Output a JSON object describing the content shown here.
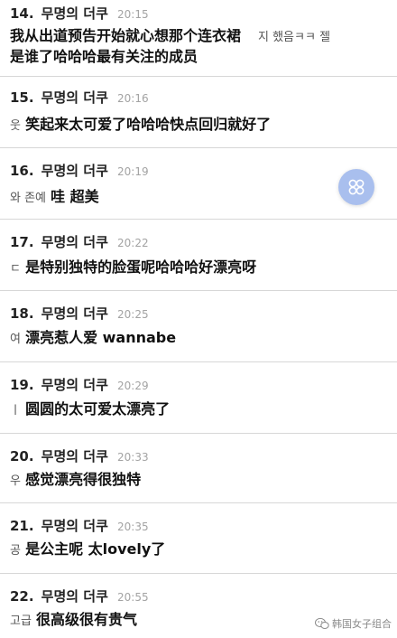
{
  "comments": [
    {
      "num": "14.",
      "user": "무명의 더쿠",
      "time": "20:15",
      "orig": "",
      "text": "我从出道预告开始就心想那个连衣裙",
      "text2": "是谁了哈哈哈最有关注的成员",
      "overlay_tail": "지 했음ㅋㅋ 젤"
    },
    {
      "num": "15.",
      "user": "무명의 더쿠",
      "time": "20:16",
      "orig": "웃",
      "text": "笑起来太可爱了哈哈哈快点回归就好了"
    },
    {
      "num": "16.",
      "user": "무명의 더쿠",
      "time": "20:19",
      "orig": "와 존예",
      "text": "哇 超美"
    },
    {
      "num": "17.",
      "user": "무명의 더쿠",
      "time": "20:22",
      "orig": "ㄷ",
      "text": "是特别独特的脸蛋呢哈哈哈好漂亮呀"
    },
    {
      "num": "18.",
      "user": "무명의 더쿠",
      "time": "20:25",
      "orig": "여",
      "text": "漂亮惹人爱 wannabe"
    },
    {
      "num": "19.",
      "user": "무명의 더쿠",
      "time": "20:29",
      "orig": "ㅣ",
      "text": "圆圆的太可爱太漂亮了"
    },
    {
      "num": "20.",
      "user": "무명의 더쿠",
      "time": "20:33",
      "orig": "우",
      "text": "感觉漂亮得很独特"
    },
    {
      "num": "21.",
      "user": "무명의 더쿠",
      "time": "20:35",
      "orig": "공",
      "text": "是公主呢 太lovely了"
    },
    {
      "num": "22.",
      "user": "무명의 더쿠",
      "time": "20:55",
      "orig": "고급",
      "text": "很高级很有贵气"
    }
  ],
  "floating_button": {
    "icon": "clover-icon"
  },
  "watermark": {
    "text": "韩国女子组合",
    "icon": "wechat-icon"
  }
}
